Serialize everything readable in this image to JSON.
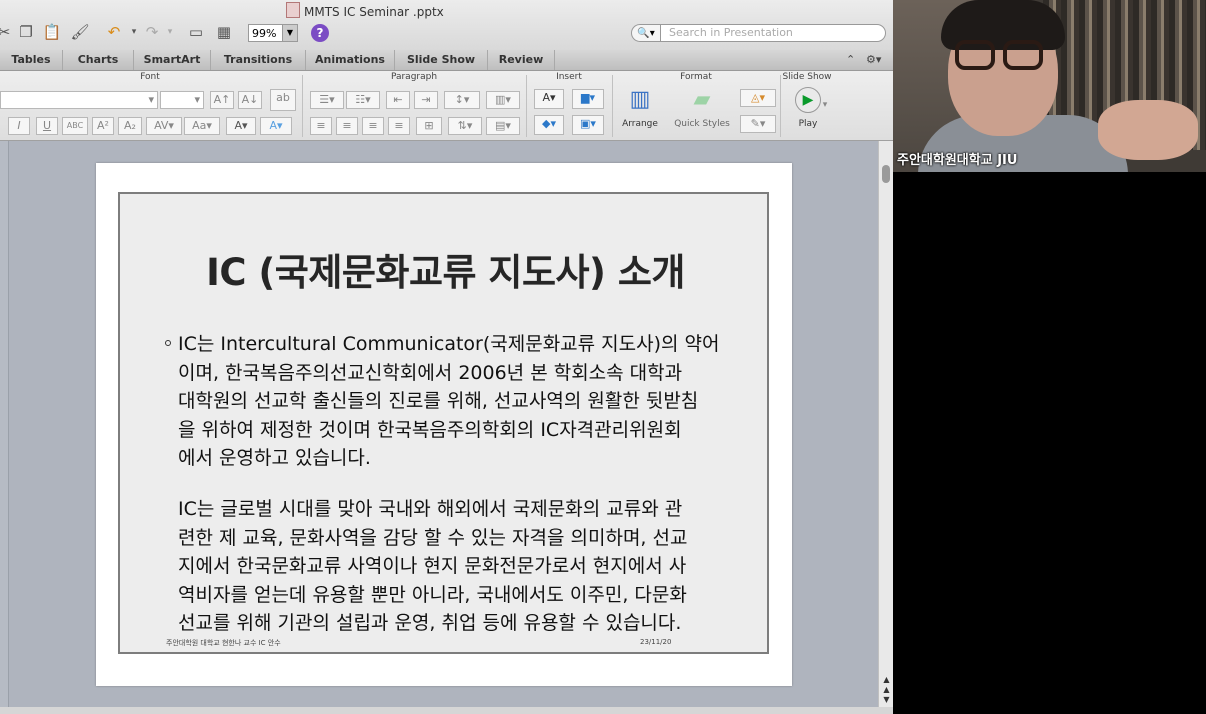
{
  "window": {
    "title": "MMTS IC Seminar .pptx"
  },
  "toolbar": {
    "zoom": "99%",
    "help_label": "?",
    "search_placeholder": "Search in Presentation"
  },
  "ribbon": {
    "tabs": [
      "Tables",
      "Charts",
      "SmartArt",
      "Transitions",
      "Animations",
      "Slide Show",
      "Review"
    ],
    "groups": {
      "font": "Font",
      "paragraph": "Paragraph",
      "insert": "Insert",
      "format": "Format",
      "slideshow": "Slide Show"
    },
    "buttons": {
      "arrange": "Arrange",
      "quick_styles": "Quick Styles",
      "play": "Play"
    }
  },
  "slide": {
    "title": "IC (국제문화교류 지도사) 소개",
    "para1": [
      "IC는 Intercultural Communicator(국제문화교류 지도사)의 약어",
      "이며, 한국복음주의선교신학회에서 2006년 본 학회소속 대학과",
      "대학원의 선교학 출신들의 진로를 위해, 선교사역의 원활한 뒷받침",
      "을 위하여 제정한 것이며 한국복음주의학회의 IC자격관리위원회",
      "에서 운영하고 있습니다."
    ],
    "para2": [
      "IC는 글로벌 시대를 맞아 국내와 해외에서 국제문화의 교류와 관",
      "련한 제 교육, 문화사역을 감당 할 수 있는 자격을 의미하며, 선교",
      "지에서 한국문화교류 사역이나 현지 문화전문가로서 현지에서 사",
      "역비자를 얻는데 유용할 뿐만 아니라, 국내에서도 이주민, 다문화",
      "선교를 위해 기관의 설립과 운영, 취업 등에 유용할 수 있습니다."
    ],
    "footer_left": "주안대학원 대학교 현한나 교수 IC 안수",
    "footer_right": "23/11/20"
  },
  "video": {
    "participant_name": "주안대학원대학교 JIU"
  }
}
